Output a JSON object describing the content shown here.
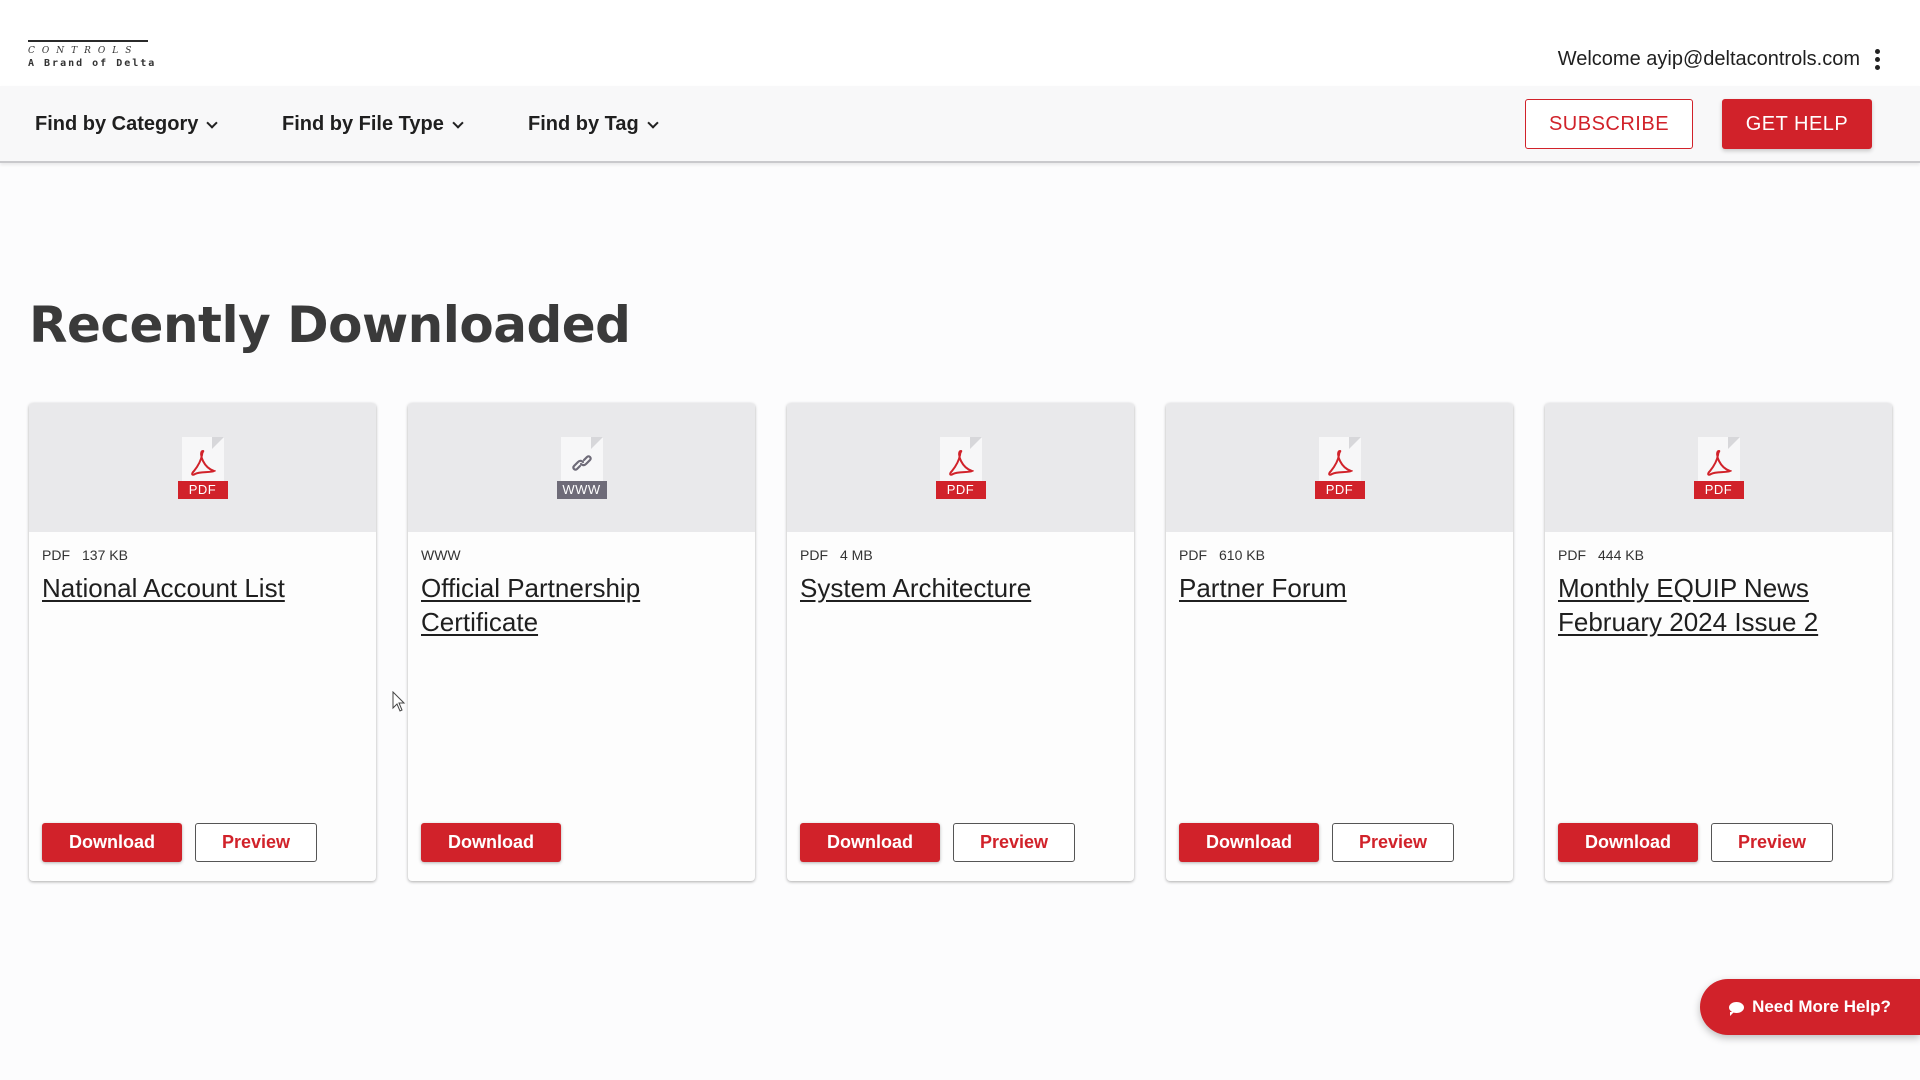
{
  "header": {
    "logo_line1": "CONTROLS",
    "logo_line2": "A Brand of Delta",
    "welcome": "Welcome ayip@deltacontrols.com"
  },
  "nav": {
    "items": [
      {
        "label": "Find by Category"
      },
      {
        "label": "Find by File Type"
      },
      {
        "label": "Find by Tag"
      }
    ],
    "subscribe": "SUBSCRIBE",
    "get_help": "GET HELP"
  },
  "section": {
    "title": "Recently Downloaded"
  },
  "cards": [
    {
      "type": "PDF",
      "size": "137 KB",
      "title": "National Account List",
      "icon": "pdf-icon",
      "download": "Download",
      "preview": "Preview"
    },
    {
      "type": "WWW",
      "size": "",
      "title": "Official Partnership Certificate",
      "icon": "link-icon",
      "download": "Download",
      "preview": ""
    },
    {
      "type": "PDF",
      "size": "4 MB",
      "title": "System Architecture",
      "icon": "pdf-icon",
      "download": "Download",
      "preview": "Preview"
    },
    {
      "type": "PDF",
      "size": "610 KB",
      "title": "Partner Forum",
      "icon": "pdf-icon",
      "download": "Download",
      "preview": "Preview"
    },
    {
      "type": "PDF",
      "size": "444 KB",
      "title": "Monthly EQUIP News February 2024 Issue 2",
      "icon": "pdf-icon",
      "download": "Download",
      "preview": "Preview"
    }
  ],
  "help_fab": {
    "label": "Need More Help?"
  },
  "colors": {
    "accent": "#d1222a",
    "www_tag": "#6e6b78",
    "card_top": "#e9e9eb"
  }
}
